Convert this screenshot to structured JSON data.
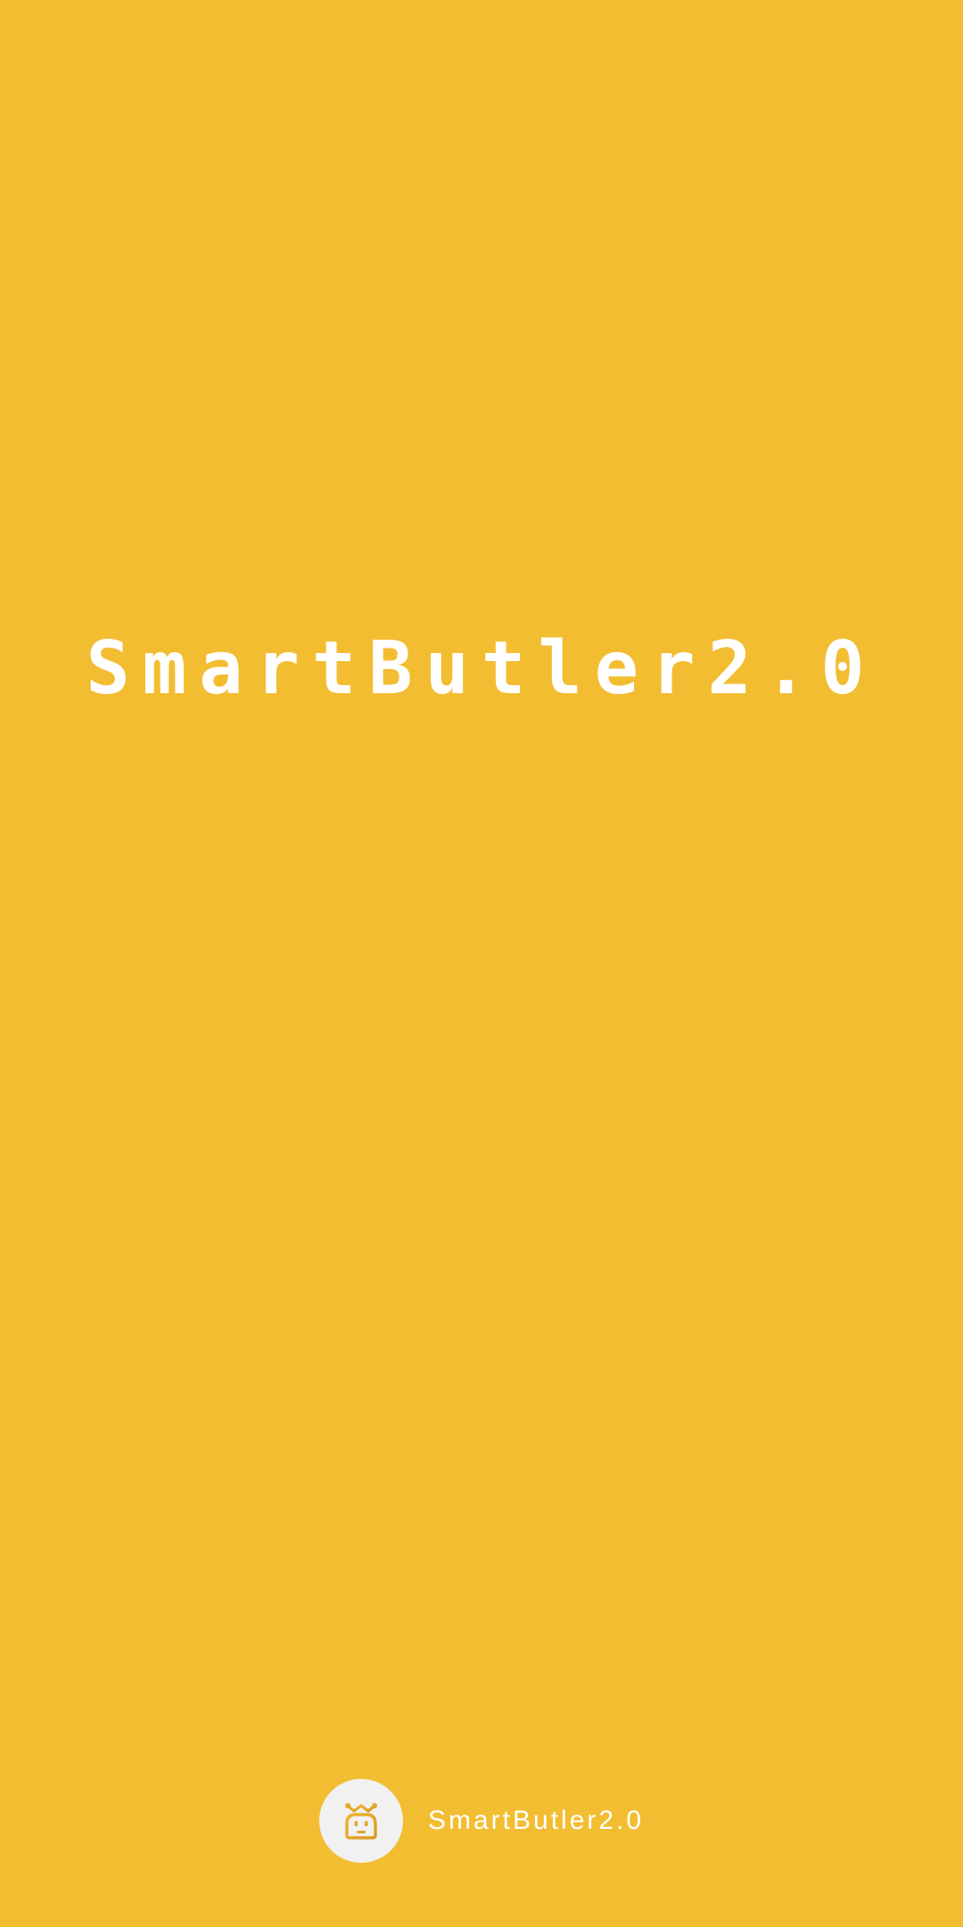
{
  "splash": {
    "title": "SmartButler2.0"
  },
  "footer": {
    "logo_icon": "robot-butler-icon",
    "app_name": "SmartButler2.0"
  },
  "colors": {
    "background": "#F3BD32",
    "text": "#FFFFFF",
    "logo_circle": "#F1F1F1",
    "logo_glyph": "#E8A92A"
  }
}
